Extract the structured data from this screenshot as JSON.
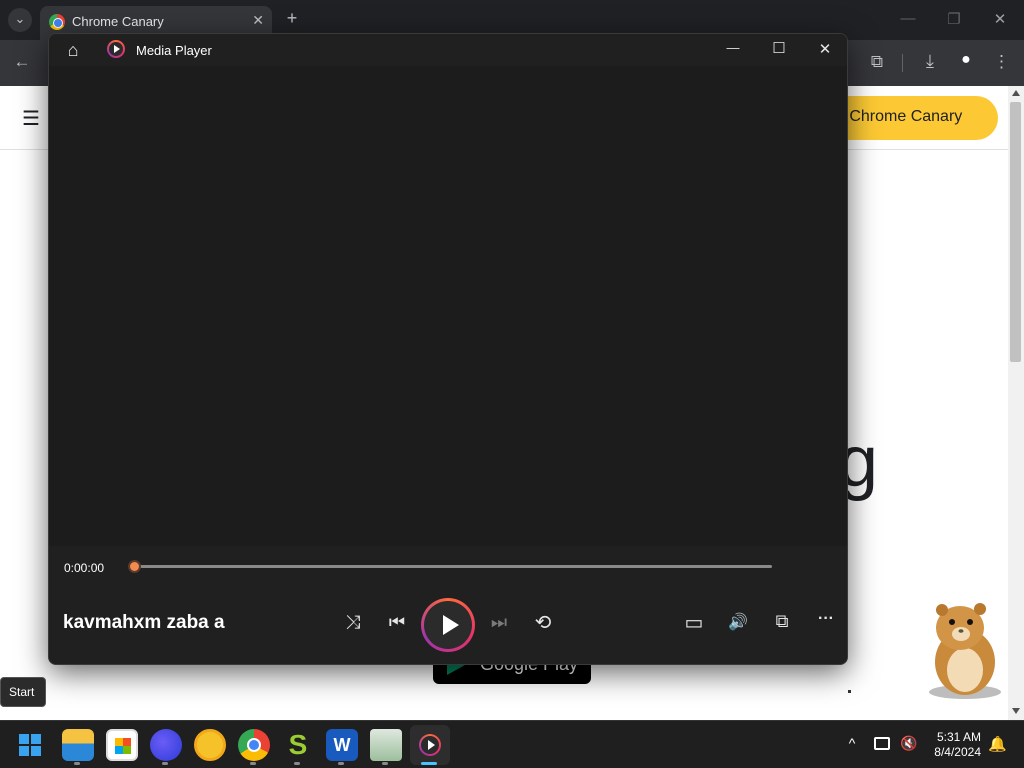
{
  "chrome": {
    "tab_title": "Chrome Canary",
    "tab_close": "✕",
    "new_tab": "+",
    "tabs_menu": "⌄",
    "win_min": "—",
    "win_restore": "❐",
    "win_close": "✕",
    "back": "←",
    "extensions": "⧉",
    "download": "⤓",
    "profile": "●",
    "menu": "⋮"
  },
  "page": {
    "hamburger": "☰",
    "download_button": "d Chrome Canary",
    "big_letter": "g",
    "google_play": "Google Play"
  },
  "media_player": {
    "app_title": "Media Player",
    "home_icon": "⌂",
    "minimize": "—",
    "maximize": "☐",
    "close": "✕",
    "current_time": "0:00:00",
    "progress": 0,
    "track_name": "kavmahxm zaba a",
    "shuffle": "⤨",
    "previous": "⏮",
    "next": "⏭",
    "repeat": "⟲",
    "captions": "▭",
    "volume": "🔊",
    "miniplayer": "⧉",
    "more": "···"
  },
  "tooltip": {
    "text": "Start"
  },
  "taskbar": {
    "time": "5:31 AM",
    "date": "8/4/2024",
    "chevron": "^",
    "apps": [
      "Start",
      "File Explorer",
      "Microsoft Store",
      "Firefox",
      "Norton",
      "Chrome",
      "Sheets",
      "Word",
      "Recycle",
      "Media Player"
    ]
  },
  "colors": {
    "accent_orange": "#f38b4e",
    "canary_yellow": "#fcc934",
    "player_bg": "#1c1c1c"
  }
}
